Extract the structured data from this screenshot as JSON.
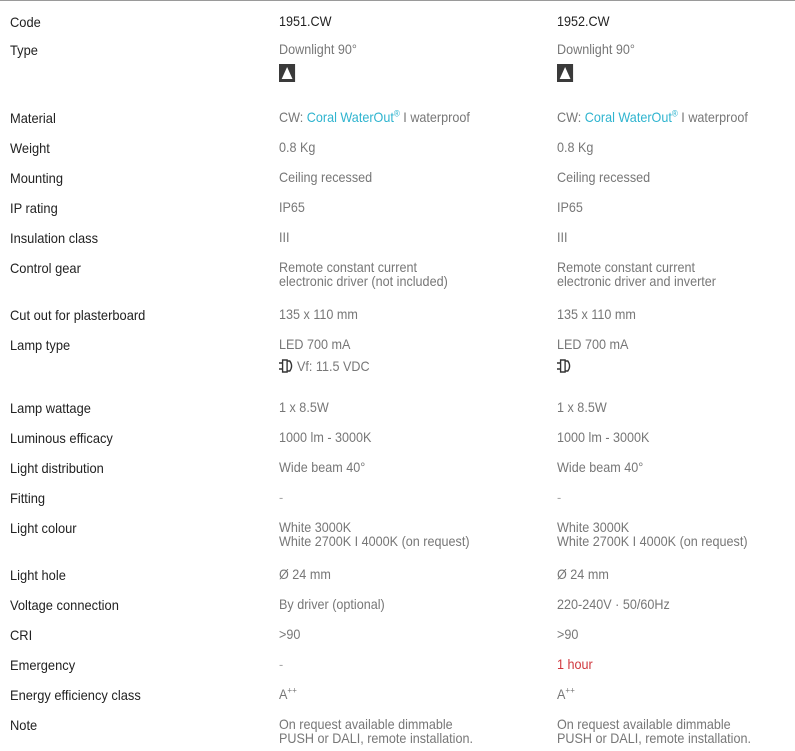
{
  "columns": {
    "a": "1951.CW",
    "b": "1952.CW"
  },
  "icons": {
    "downlight": "downlight-beam-icon",
    "driver": "led-driver-plug-icon"
  },
  "colors": {
    "link": "#2fb4cf",
    "emergency": "#d0383e"
  },
  "rows": [
    {
      "label": "Code",
      "a": "1951.CW",
      "b": "1952.CW"
    },
    {
      "label": "Type",
      "a": "Downlight 90°",
      "b": "Downlight 90°"
    },
    {
      "label": "Material",
      "a_prefix": "CW: ",
      "a_link": "Coral WaterOut",
      "a_sup": "®",
      "a_suffix": " I waterproof",
      "b_prefix": "CW: ",
      "b_link": "Coral WaterOut",
      "b_sup": "®",
      "b_suffix": " I waterproof"
    },
    {
      "label": "Weight",
      "a": "0.8 Kg",
      "b": "0.8 Kg"
    },
    {
      "label": "Mounting",
      "a": "Ceiling recessed",
      "b": "Ceiling recessed"
    },
    {
      "label": "IP rating",
      "a": "IP65",
      "b": "IP65"
    },
    {
      "label": "Insulation class",
      "a": "III",
      "b": "III"
    },
    {
      "label": "Control gear",
      "a1": "Remote constant current",
      "a2": "electronic driver (not included)",
      "b1": "Remote constant current",
      "b2": "electronic driver and inverter"
    },
    {
      "label": "Cut out for plasterboard",
      "a": "135 x 110 mm",
      "b": "135 x 110 mm"
    },
    {
      "label": "Lamp type",
      "a": "LED 700 mA",
      "a_sub": "Vf: 11.5 VDC",
      "b": "LED 700 mA",
      "b_sub": ""
    },
    {
      "label": "Lamp wattage",
      "a": "1 x 8.5W",
      "b": "1 x 8.5W"
    },
    {
      "label": "Luminous efficacy",
      "a": "1000 lm - 3000K",
      "b": "1000 lm - 3000K"
    },
    {
      "label": "Light distribution",
      "a": "Wide beam 40°",
      "b": "Wide beam 40°"
    },
    {
      "label": "Fitting",
      "a": "-",
      "b": "-"
    },
    {
      "label": "Light colour",
      "a1": "White 3000K",
      "a2": "White 2700K I 4000K (on request)",
      "b1": "White 3000K",
      "b2": "White 2700K I 4000K (on request)"
    },
    {
      "label": "Light hole",
      "a": "Ø 24 mm",
      "b": "Ø 24 mm"
    },
    {
      "label": "Voltage connection",
      "a": "By driver (optional)",
      "b": "220-240V · 50/60Hz"
    },
    {
      "label": "CRI",
      "a": ">90",
      "b": ">90"
    },
    {
      "label": "Emergency",
      "a": "-",
      "b": "1 hour"
    },
    {
      "label": "Energy efficiency class",
      "a_base": "A",
      "a_sup": "++",
      "b_base": "A",
      "b_sup": "++"
    },
    {
      "label": "Note",
      "a1": "On request available dimmable",
      "a2": "PUSH or DALI, remote installation.",
      "b1": "On request available dimmable",
      "b2": "PUSH or DALI, remote installation."
    }
  ]
}
